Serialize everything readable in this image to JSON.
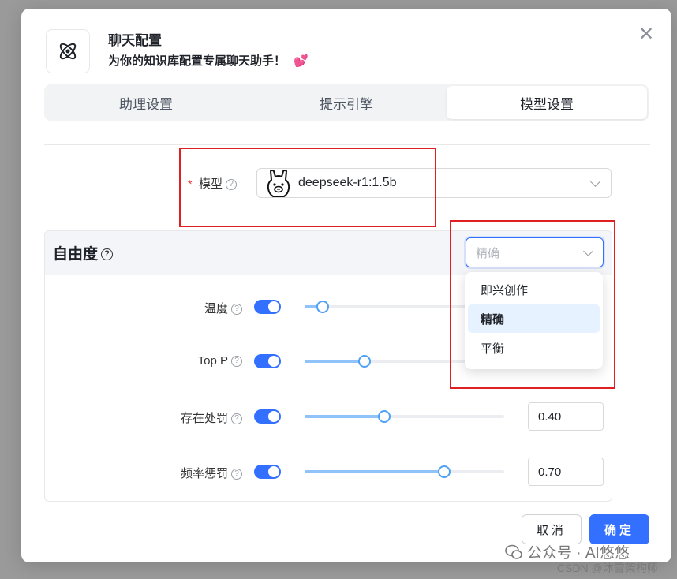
{
  "dialog": {
    "title": "聊天配置",
    "subtitle": "为你的知识库配置专属聊天助手！",
    "close_icon": "close-icon",
    "app_icon": "atom-icon"
  },
  "tabs": [
    {
      "label": "助理设置",
      "active": false
    },
    {
      "label": "提示引擎",
      "active": false
    },
    {
      "label": "模型设置",
      "active": true
    }
  ],
  "model": {
    "label": "模型",
    "required_mark": "*",
    "value": "deepseek-r1:1.5b",
    "icon": "ollama-llama-icon"
  },
  "freedom": {
    "title": "自由度",
    "select_value": "精确",
    "options": [
      "即兴创作",
      "精确",
      "平衡"
    ],
    "selected_option": "精确"
  },
  "params": [
    {
      "label": "温度",
      "enabled": true,
      "fraction": 0.09,
      "value": ""
    },
    {
      "label": "Top P",
      "enabled": true,
      "fraction": 0.3,
      "value": ""
    },
    {
      "label": "存在处罚",
      "enabled": true,
      "fraction": 0.4,
      "value": "0.40"
    },
    {
      "label": "频率惩罚",
      "enabled": true,
      "fraction": 0.7,
      "value": "0.70"
    }
  ],
  "footer": {
    "cancel_label": "取消",
    "ok_label": "确定"
  },
  "watermark": {
    "line1": "公众号 · AI悠悠",
    "line2": "CSDN @沐雪架构师"
  },
  "colors": {
    "accent": "#3370ff",
    "slider_fill": "#91c3fb",
    "annotation_red": "#e02020"
  }
}
